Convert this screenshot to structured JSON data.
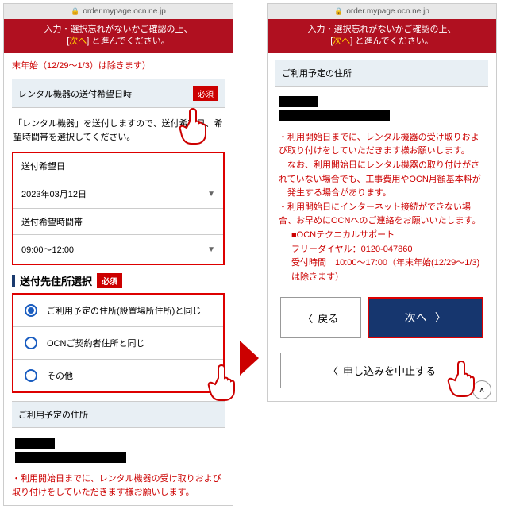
{
  "url": "order.mypage.ocn.ne.jp",
  "banner": {
    "line1": "入力・選択忘れがないかご確認の上、",
    "prefix": "[",
    "next": "次へ",
    "suffix": "] と進んでください。"
  },
  "left": {
    "top_note": "末年始（12/29～1/3）は除きます）",
    "ship_header": "レンタル機器の送付希望日時",
    "required": "必須",
    "ship_desc": "「レンタル機器」を送付しますので、送付希望日、希望時間帯を選択してください。",
    "date_label": "送付希望日",
    "date_value": "2023年03月12日",
    "time_label": "送付希望時間帯",
    "time_value": "09:00～12:00",
    "addr_title": "送付先住所選択",
    "radio1": "ご利用予定の住所(設置場所住所)と同じ",
    "radio2": "OCNご契約者住所と同じ",
    "radio3": "その他",
    "addr_header": "ご利用予定の住所",
    "bottom_note": "・利用開始日までに、レンタル機器の受け取りおよび取り付けをしていただきます様お願いします。"
  },
  "right": {
    "addr_header": "ご利用予定の住所",
    "info1": "・利用開始日までに、レンタル機器の受け取りおよび取り付けをしていただきます様お願いします。",
    "info2": "　なお、利用開始日にレンタル機器の取り付けがされていない場合でも、工事費用やOCN月額基本料が",
    "info3": "　発生する場合があります。",
    "info4": "・利用開始日にインターネット接続ができない場合、お早めにOCNへのご連絡をお願いいたします。",
    "support_title": "■OCNテクニカルサポート",
    "support_dial": "フリーダイヤル：0120-047860",
    "support_hours": "受付時間　10:00～17:00（年末年始(12/29～1/3)は除きます）",
    "back": "戻る",
    "next": "次へ",
    "cancel": "申し込みを中止する"
  }
}
